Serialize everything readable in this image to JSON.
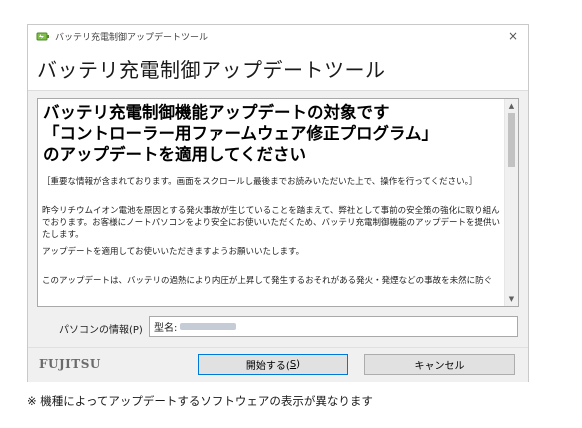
{
  "window": {
    "title": "バッテリ充電制御アップデートツール",
    "close_glyph": "×"
  },
  "header": {
    "title": "バッテリ充電制御アップデートツール"
  },
  "content": {
    "headline_1": "バッテリ充電制御機能アップデートの対象です",
    "headline_2": "「コントローラー用ファームウェア修正プログラム」",
    "headline_3": "のアップデートを適用してください",
    "para_1": "［重要な情報が含まれております。画面をスクロールし最後までお読みいただいた上で、操作を行ってください。］",
    "para_2": "昨今リチウムイオン電池を原因とする発火事故が生じていることを踏まえて、弊社として事前の安全策の強化に取り組んでおります。お客様にノートパソコンをより安全にお使いいただくため、バッテリ充電制御機能のアップデートを提供いたします。",
    "para_3": "アップデートを適用してお使いいただきますようお願いいたします。",
    "para_4": "このアップデートは、バッテリの過熱により内圧が上昇して発生するおそれがある発火・発煙などの事故を未然に防ぐ"
  },
  "info": {
    "label": "パソコンの情報(P)",
    "model_label": "型名:"
  },
  "footer": {
    "logo_text": "FUJITSU",
    "start_label": "開始する(",
    "start_key": "S",
    "start_close": ")",
    "cancel_label": "キャンセル"
  },
  "note": "※ 機種によってアップデートするソフトウェアの表示が異なります",
  "icons": {
    "app": "battery-icon",
    "scroll_up": "▲",
    "scroll_down": "▼"
  },
  "colors": {
    "accent_border": "#0078d7",
    "window_bg": "#f0f0f0"
  }
}
